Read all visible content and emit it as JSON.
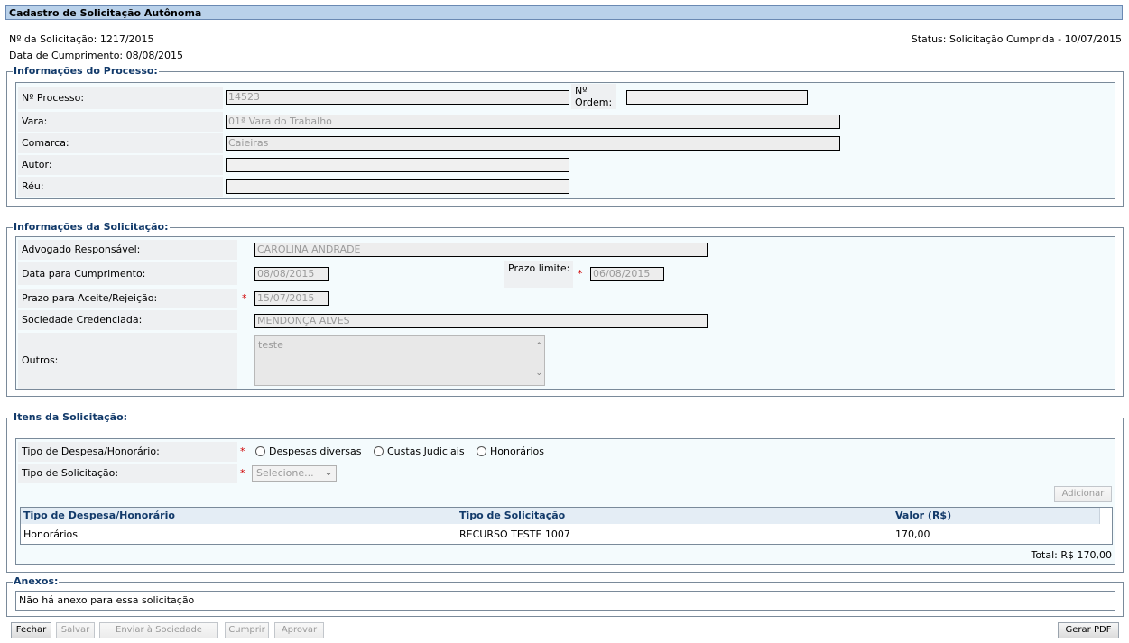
{
  "title": "Cadastro de Solicitação Autônoma",
  "header": {
    "numero": "Nº da Solicitação: 1217/2015",
    "data_cumprimento": "Data de Cumprimento: 08/08/2015",
    "status": "Status: Solicitação Cumprida - 10/07/2015"
  },
  "processo": {
    "legend": "Informações do Processo:",
    "labels": {
      "processo": "Nº Processo:",
      "ordem": "Nº Ordem:",
      "vara": "Vara:",
      "comarca": "Comarca:",
      "autor": "Autor:",
      "reu": "Réu:"
    },
    "values": {
      "processo": "14523",
      "ordem": "",
      "vara": "01ª Vara do Trabalho",
      "comarca": "Caieiras",
      "autor": "",
      "reu": ""
    }
  },
  "solicitacao": {
    "legend": "Informações da Solicitação:",
    "labels": {
      "advogado": "Advogado Responsável:",
      "data": "Data para Cumprimento:",
      "prazo_limite": "Prazo limite:",
      "prazo_aceite": "Prazo para Aceite/Rejeição:",
      "sociedade": "Sociedade Credenciada:",
      "outros": "Outros:"
    },
    "values": {
      "advogado": "CAROLINA ANDRADE",
      "data": "08/08/2015",
      "prazo_limite": "06/08/2015",
      "prazo_aceite": "15/07/2015",
      "sociedade": "MENDONÇA ALVES",
      "outros": "teste"
    },
    "required_mark": "*"
  },
  "itens": {
    "legend": "Itens da Solicitação:",
    "tipo_despesa_label": "Tipo de Despesa/Honorário:",
    "tipo_solicitacao_label": "Tipo de Solicitação:",
    "radio_options": [
      "Despesas diversas",
      "Custas Judiciais",
      "Honorários"
    ],
    "select_value": "Selecione...",
    "add_button": "Adicionar",
    "table_headers": [
      "Tipo de Despesa/Honorário",
      "Tipo de Solicitação",
      "Valor (R$)"
    ],
    "rows": [
      [
        "Honorários",
        "RECURSO TESTE 1007",
        "170,00"
      ]
    ],
    "total": "Total: R$ 170,00"
  },
  "anexos": {
    "legend": "Anexos:",
    "message": "Não há anexo para essa solicitação"
  },
  "buttons": {
    "fechar": "Fechar",
    "salvar": "Salvar",
    "enviar": "Enviar à Sociedade",
    "cumprir": "Cumprir",
    "aprovar": "Aprovar",
    "pdf": "Gerar PDF"
  },
  "colors": {
    "titlebar": "#b9d1ea",
    "legend": "#123a6a",
    "required": "#d00000"
  }
}
